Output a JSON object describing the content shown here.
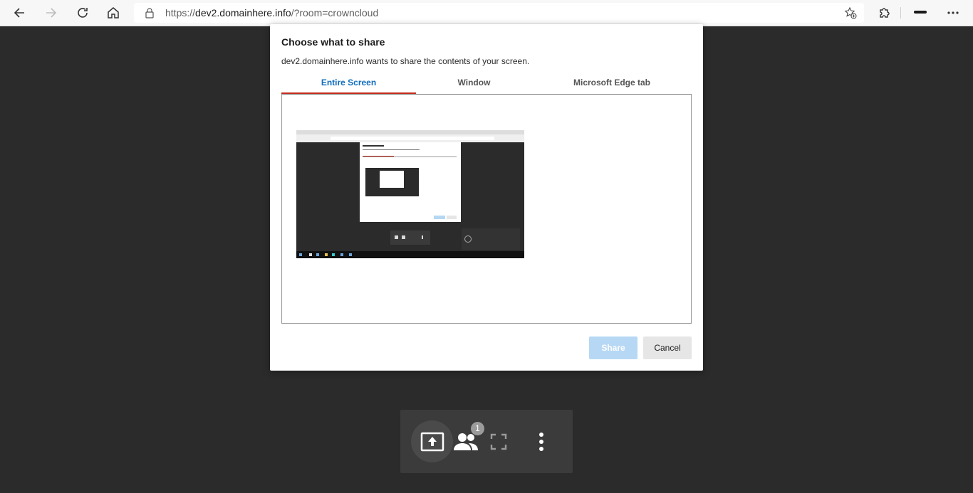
{
  "browser": {
    "url_scheme": "https://",
    "url_host": "dev2.domainhere.info",
    "url_rest": "/?room=crowncloud",
    "icons": [
      "back-icon",
      "forward-icon",
      "refresh-icon",
      "home-icon",
      "lock-icon",
      "add-favorite-icon",
      "extensions-icon",
      "more-icon"
    ]
  },
  "dialog": {
    "title": "Choose what to share",
    "subtitle": "dev2.domainhere.info wants to share the contents of your screen.",
    "tabs": [
      {
        "label": "Entire Screen"
      },
      {
        "label": "Window"
      },
      {
        "label": "Microsoft Edge tab"
      }
    ],
    "share_label": "Share",
    "cancel_label": "Cancel"
  },
  "controls": {
    "participant_count": "1",
    "icons": [
      "screen-share-icon",
      "participants-icon",
      "fullscreen-icon",
      "more-options-icon"
    ]
  },
  "colors": {
    "accent_blue": "#0f6cbd",
    "tab_underline": "#c42b1c",
    "share_disabled": "#b7d8f5",
    "background": "#2b2b2b",
    "control_bar": "#3b3b3b"
  }
}
